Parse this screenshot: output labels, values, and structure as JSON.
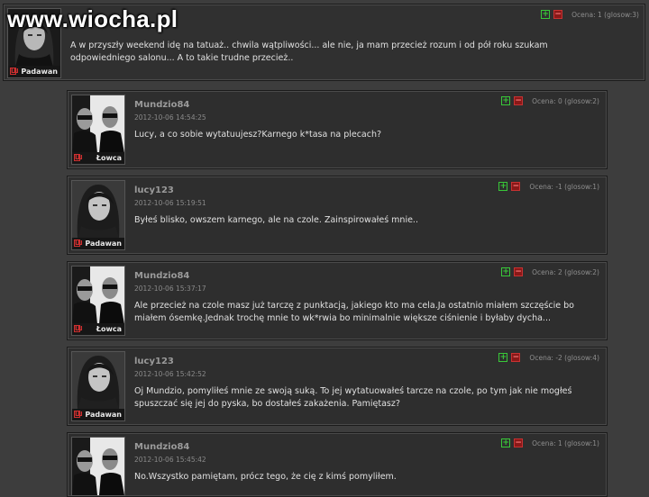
{
  "site": {
    "watermark": "www.wiocha.pl"
  },
  "vote_label_plus": "+",
  "vote_label_minus": "−",
  "first_post": {
    "rank": "Padawan",
    "score": "Ocena: 1 (glosow:3)",
    "text": "A w przyszły weekend idę na tatuaż.. chwila wątpliwości... ale nie, ja mam przecież rozum i od pół roku szukam odpowiedniego salonu... A to takie trudne przecież.."
  },
  "replies": [
    {
      "author": "Mundzio84",
      "date": "2012-10-06 14:54:25",
      "rank": "Łowca",
      "score": "Ocena: 0 (glosow:2)",
      "text": "Lucy, a co sobie wytatuujesz?Karnego k*tasa na plecach?"
    },
    {
      "author": "lucy123",
      "date": "2012-10-06 15:19:51",
      "rank": "Padawan",
      "score": "Ocena: -1 (glosow:1)",
      "text": "Byłeś blisko, owszem karnego, ale na czole. Zainspirowałeś mnie.."
    },
    {
      "author": "Mundzio84",
      "date": "2012-10-06 15:37:17",
      "rank": "Łowca",
      "score": "Ocena: 2 (glosow:2)",
      "text": "Ale przecież na czole masz już tarczę z punktacją, jakiego kto ma cela.Ja ostatnio miałem szczęście bo miałem ósemkę.Jednak trochę mnie to wk*rwia bo minimalnie większe ciśnienie i byłaby dycha..."
    },
    {
      "author": "lucy123",
      "date": "2012-10-06 15:42:52",
      "rank": "Padawan",
      "score": "Ocena: -2 (glosow:4)",
      "text": "Oj Mundzio, pomyliłeś mnie ze swoją suką. To jej wytatuowałeś tarcze na czole, po tym jak nie mogłeś spuszczać się jej do pyska, bo dostałeś zakażenia. Pamiętasz?"
    },
    {
      "author": "Mundzio84",
      "date": "2012-10-06 15:45:42",
      "rank": "Łowca",
      "score": "Ocena: 1 (glosow:1)",
      "text": "No.Wszystko pamiętam, prócz tego, że cię z kimś pomyliłem."
    }
  ]
}
